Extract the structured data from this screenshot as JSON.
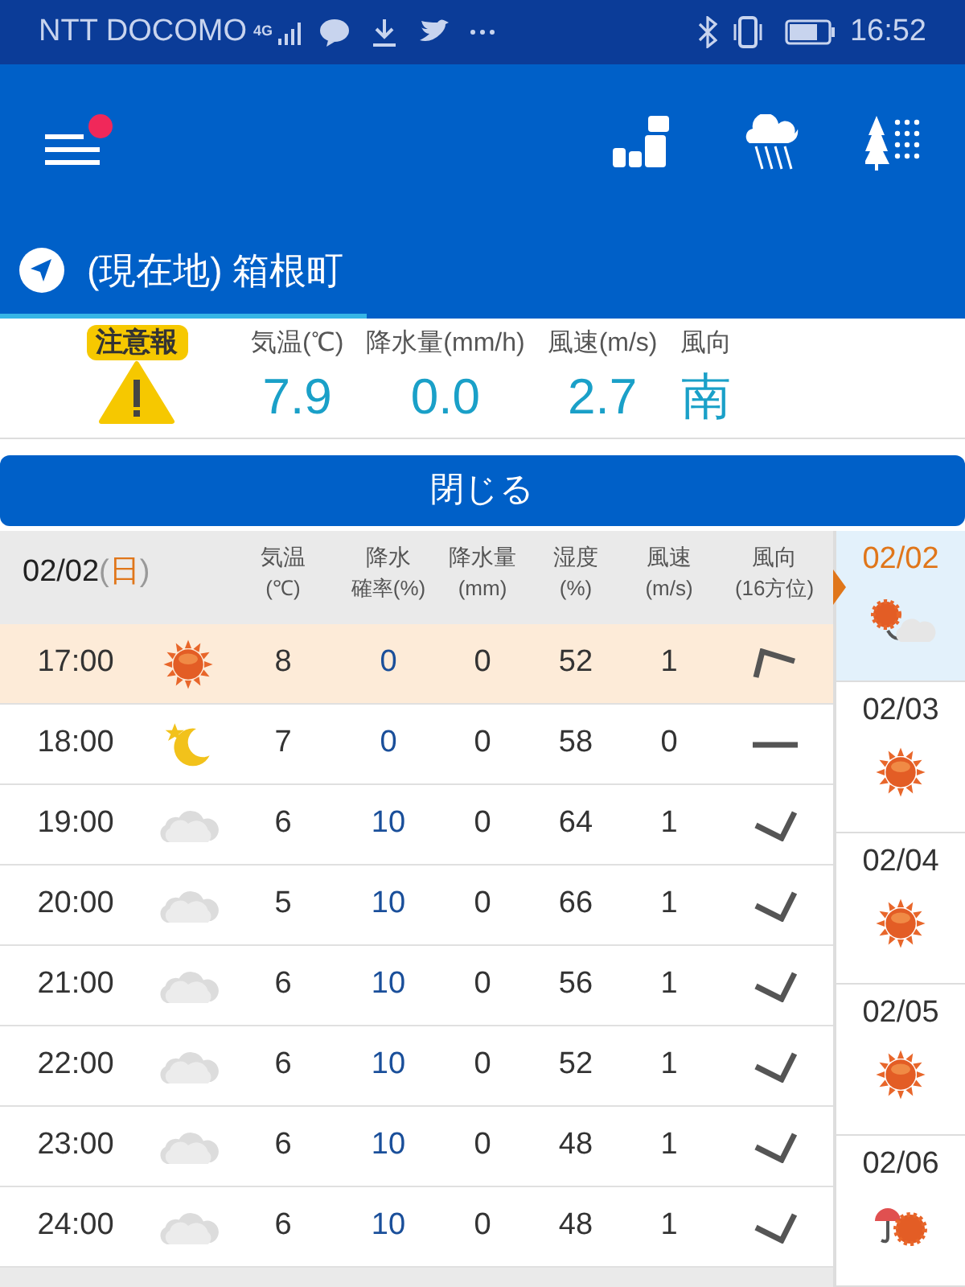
{
  "status_bar": {
    "carrier": "NTT DOCOMO",
    "network": "4G",
    "time": "16:52"
  },
  "app_bar": {
    "menu_badge": true
  },
  "location": {
    "title": "(現在地) 箱根町"
  },
  "current": {
    "alert": "注意報",
    "items": [
      {
        "label": "気温(℃)",
        "value": "7.9"
      },
      {
        "label": "降水量(mm/h)",
        "value": "0.0"
      },
      {
        "label": "風速(m/s)",
        "value": "2.7"
      },
      {
        "label": "風向",
        "value": "南"
      }
    ]
  },
  "close_button": "閉じる",
  "table": {
    "date": "02/02",
    "weekday_open": "(",
    "weekday": "日",
    "weekday_close": ")",
    "columns": [
      {
        "line1": "気温",
        "line2": "(℃)"
      },
      {
        "line1": "降水",
        "line2": "確率(%)"
      },
      {
        "line1": "降水量",
        "line2": "(mm)"
      },
      {
        "line1": "湿度",
        "line2": "(%)"
      },
      {
        "line1": "風速",
        "line2": "(m/s)"
      },
      {
        "line1": "風向",
        "line2": "(16方位)"
      }
    ],
    "rows": [
      {
        "time": "17:00",
        "weather_icon": {
          "kind": "sun"
        },
        "temp": "8",
        "prob": "0",
        "amount": "0",
        "humidity": "52",
        "speed": "1",
        "wind_icon": {
          "kind": "peak"
        },
        "selected": true
      },
      {
        "time": "18:00",
        "weather_icon": {
          "kind": "moon"
        },
        "temp": "7",
        "prob": "0",
        "amount": "0",
        "humidity": "58",
        "speed": "0",
        "wind_icon": {
          "kind": "dash"
        },
        "selected": false
      },
      {
        "time": "19:00",
        "weather_icon": {
          "kind": "cloud"
        },
        "temp": "6",
        "prob": "10",
        "amount": "0",
        "humidity": "64",
        "speed": "1",
        "wind_icon": {
          "kind": "tick"
        },
        "selected": false
      },
      {
        "time": "20:00",
        "weather_icon": {
          "kind": "cloud"
        },
        "temp": "5",
        "prob": "10",
        "amount": "0",
        "humidity": "66",
        "speed": "1",
        "wind_icon": {
          "kind": "tick"
        },
        "selected": false
      },
      {
        "time": "21:00",
        "weather_icon": {
          "kind": "cloud"
        },
        "temp": "6",
        "prob": "10",
        "amount": "0",
        "humidity": "56",
        "speed": "1",
        "wind_icon": {
          "kind": "tick"
        },
        "selected": false
      },
      {
        "time": "22:00",
        "weather_icon": {
          "kind": "cloud"
        },
        "temp": "6",
        "prob": "10",
        "amount": "0",
        "humidity": "52",
        "speed": "1",
        "wind_icon": {
          "kind": "tick"
        },
        "selected": false
      },
      {
        "time": "23:00",
        "weather_icon": {
          "kind": "cloud"
        },
        "temp": "6",
        "prob": "10",
        "amount": "0",
        "humidity": "48",
        "speed": "1",
        "wind_icon": {
          "kind": "tick"
        },
        "selected": false
      },
      {
        "time": "24:00",
        "weather_icon": {
          "kind": "cloud"
        },
        "temp": "6",
        "prob": "10",
        "amount": "0",
        "humidity": "48",
        "speed": "1",
        "wind_icon": {
          "kind": "tick"
        },
        "selected": false
      }
    ]
  },
  "days": [
    {
      "date": "02/02",
      "weather_icon": {
        "kind": "sun-cloud"
      },
      "selected": true
    },
    {
      "date": "02/03",
      "weather_icon": {
        "kind": "sun"
      },
      "selected": false
    },
    {
      "date": "02/04",
      "weather_icon": {
        "kind": "sun"
      },
      "selected": false
    },
    {
      "date": "02/05",
      "weather_icon": {
        "kind": "sun"
      },
      "selected": false
    },
    {
      "date": "02/06",
      "weather_icon": {
        "kind": "sun-rain"
      },
      "selected": false
    }
  ]
}
